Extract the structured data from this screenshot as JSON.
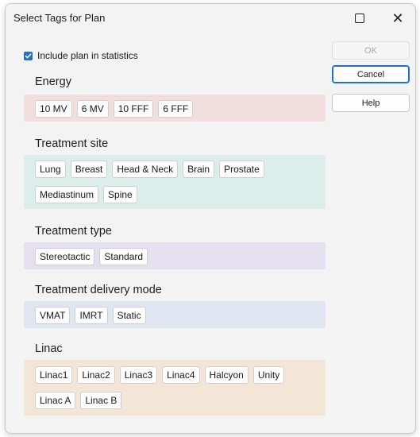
{
  "window": {
    "title": "Select Tags for Plan"
  },
  "include_statistics": {
    "label": "Include plan in statistics",
    "checked": true
  },
  "buttons": {
    "ok": "OK",
    "cancel": "Cancel",
    "help": "Help"
  },
  "groups": [
    {
      "title": "Energy",
      "color": "#f1dedd",
      "tags": [
        "10 MV",
        "6 MV",
        "10 FFF",
        "6 FFF"
      ]
    },
    {
      "title": "Treatment site",
      "color": "#dceee9",
      "tags": [
        "Lung",
        "Breast",
        "Head & Neck",
        "Brain",
        "Prostate",
        "Mediastinum",
        "Spine"
      ]
    },
    {
      "title": "Treatment type",
      "color": "#e4e0ef",
      "tags": [
        "Stereotactic",
        "Standard"
      ]
    },
    {
      "title": "Treatment delivery mode",
      "color": "#dfe6f1",
      "tags": [
        "VMAT",
        "IMRT",
        "Static"
      ]
    },
    {
      "title": "Linac",
      "color": "#f3e6d7",
      "tags": [
        "Linac1",
        "Linac2",
        "Linac3",
        "Linac4",
        "Halcyon",
        "Unity",
        "Linac A",
        "Linac B"
      ]
    }
  ],
  "colors": {
    "accent": "#1f6fcf"
  },
  "icons": {
    "maximize": "maximize-icon",
    "close": "close-icon",
    "checkbox": "checkbox-checked-icon"
  }
}
